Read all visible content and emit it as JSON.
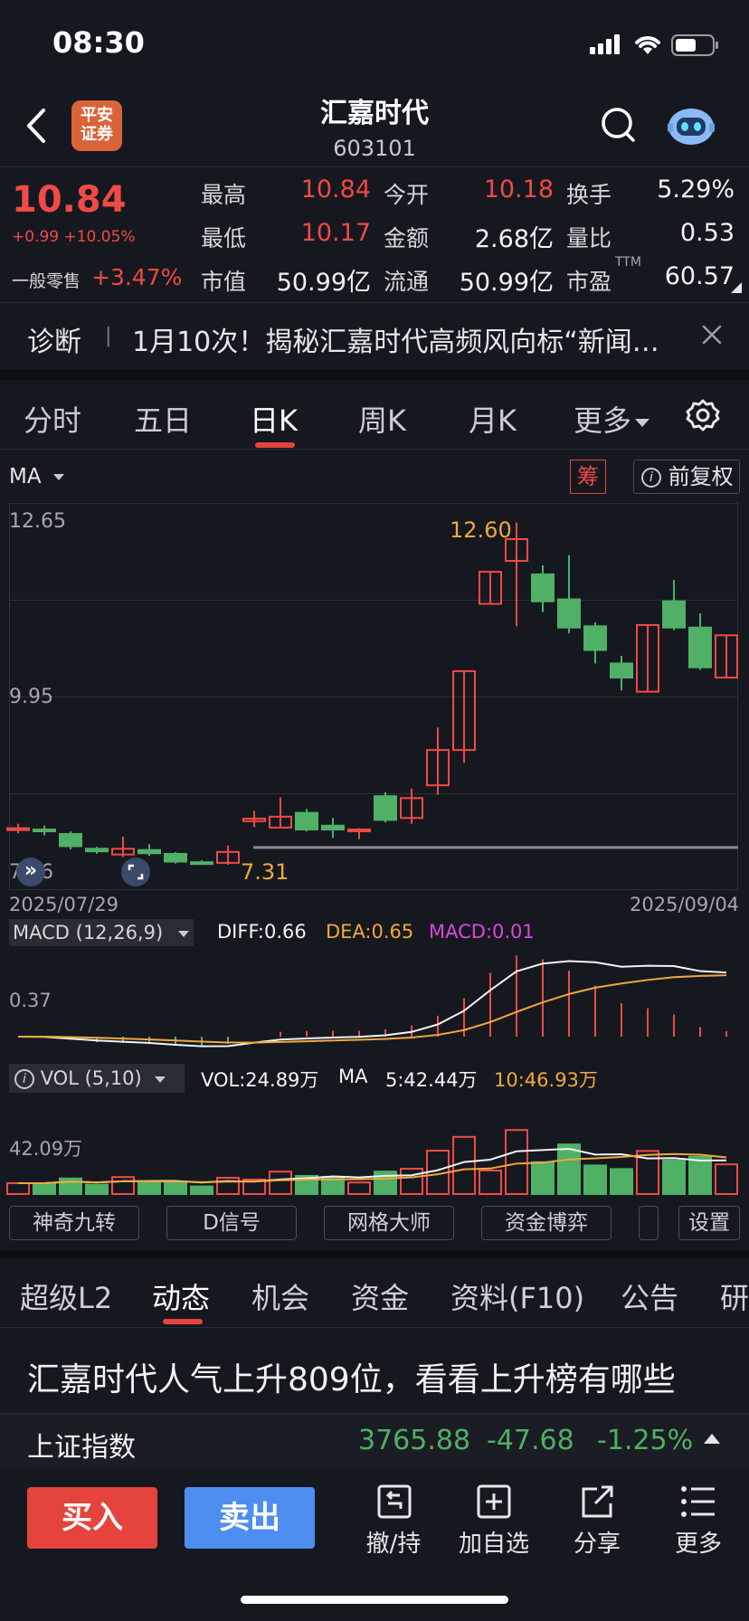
{
  "status": {
    "time": "08:30"
  },
  "header": {
    "title": "汇嘉时代",
    "code": "603101",
    "logo_text_1": "平安",
    "logo_text_2": "证券"
  },
  "quote": {
    "price": "10.84",
    "change": "+0.99 +10.05%",
    "retail_label": "一般零售",
    "retail_change": "+3.47%",
    "rows": [
      [
        {
          "label": "最高",
          "value": "10.84",
          "color": "red"
        },
        {
          "label": "今开",
          "value": "10.18",
          "color": "red"
        },
        {
          "label": "换手",
          "value": "5.29%",
          "color": "white"
        }
      ],
      [
        {
          "label": "最低",
          "value": "10.17",
          "color": "red"
        },
        {
          "label": "金额",
          "value": "2.68亿",
          "color": "white"
        },
        {
          "label": "量比",
          "value": "0.53",
          "color": "white"
        }
      ],
      [
        {
          "label": "市值",
          "value": "50.99亿",
          "color": "white"
        },
        {
          "label": "流通",
          "value": "50.99亿",
          "color": "white"
        },
        {
          "label": "市盈",
          "value": "60.57",
          "color": "white"
        }
      ]
    ],
    "pe_superscript": "TTM"
  },
  "diagnosis": {
    "label": "诊断",
    "separator": "|",
    "text": "1月10次！揭秘汇嘉时代高频风向标“新闻…"
  },
  "chart_tabs": [
    "分时",
    "五日",
    "日K",
    "周K",
    "月K",
    "更多"
  ],
  "chart_active_tab": 2,
  "chart_toolbar": {
    "ma_label": "MA",
    "chip_label": "筹",
    "adjust_label": "前复权"
  },
  "chart_data": {
    "type": "candlestick",
    "y_top_label": "12.65",
    "y_mid_label": "9.95",
    "y_bottom_label": "7.26",
    "x_start": "2025/07/29",
    "x_end": "2025/09/04",
    "high_marker": "12.60",
    "low_marker": "7.31",
    "ylim": [
      7.26,
      12.65
    ],
    "candles": [
      {
        "o": 7.83,
        "c": 7.83,
        "h": 7.9,
        "l": 7.75
      },
      {
        "o": 7.81,
        "c": 7.79,
        "h": 7.87,
        "l": 7.72
      },
      {
        "o": 7.74,
        "c": 7.55,
        "h": 7.78,
        "l": 7.5
      },
      {
        "o": 7.51,
        "c": 7.47,
        "h": 7.54,
        "l": 7.43
      },
      {
        "o": 7.42,
        "c": 7.51,
        "h": 7.7,
        "l": 7.38
      },
      {
        "o": 7.49,
        "c": 7.44,
        "h": 7.58,
        "l": 7.4
      },
      {
        "o": 7.43,
        "c": 7.31,
        "h": 7.46,
        "l": 7.28
      },
      {
        "o": 7.3,
        "c": 7.29,
        "h": 7.33,
        "l": 7.27
      },
      {
        "o": 7.29,
        "c": 7.46,
        "h": 7.56,
        "l": 7.26
      },
      {
        "o": 7.94,
        "c": 7.98,
        "h": 8.1,
        "l": 7.85
      },
      {
        "o": 7.84,
        "c": 8.01,
        "h": 8.31,
        "l": 7.84
      },
      {
        "o": 8.07,
        "c": 7.81,
        "h": 8.13,
        "l": 7.78
      },
      {
        "o": 7.87,
        "c": 7.81,
        "h": 7.99,
        "l": 7.68
      },
      {
        "o": 7.81,
        "c": 7.81,
        "h": 7.83,
        "l": 7.66
      },
      {
        "o": 8.33,
        "c": 7.96,
        "h": 8.39,
        "l": 7.92
      },
      {
        "o": 7.99,
        "c": 8.3,
        "h": 8.45,
        "l": 7.9
      },
      {
        "o": 8.5,
        "c": 9.05,
        "h": 9.4,
        "l": 8.35
      },
      {
        "o": 9.05,
        "c": 10.28,
        "h": 10.28,
        "l": 8.85
      },
      {
        "o": 11.33,
        "c": 11.83,
        "h": 11.83,
        "l": 11.33
      },
      {
        "o": 12.0,
        "c": 12.34,
        "h": 12.6,
        "l": 10.98
      },
      {
        "o": 11.79,
        "c": 11.37,
        "h": 11.93,
        "l": 11.2
      },
      {
        "o": 11.4,
        "c": 10.96,
        "h": 12.09,
        "l": 10.87
      },
      {
        "o": 10.98,
        "c": 10.61,
        "h": 11.04,
        "l": 10.4
      },
      {
        "o": 10.4,
        "c": 10.18,
        "h": 10.52,
        "l": 9.98
      },
      {
        "o": 9.96,
        "c": 11.0,
        "h": 11.0,
        "l": 9.96
      },
      {
        "o": 11.37,
        "c": 10.96,
        "h": 11.7,
        "l": 10.92
      },
      {
        "o": 10.96,
        "c": 10.34,
        "h": 11.18,
        "l": 10.3
      },
      {
        "o": 10.18,
        "c": 10.84,
        "h": 10.84,
        "l": 10.17
      }
    ],
    "macd": {
      "label": "MACD (12,26,9)",
      "diff": "DIFF:0.66",
      "dea": "DEA:0.65",
      "value": "MACD:0.01",
      "y_label": "0.37"
    },
    "vol": {
      "label": "VOL (5,10)",
      "vol": "VOL:24.89万",
      "ma_label": "MA",
      "ma5": "5:42.44万",
      "ma10": "10:46.93万",
      "y_label": "42.09万"
    }
  },
  "indicator_buttons": [
    "神奇九转",
    "D信号",
    "网格大师",
    "资金博弈",
    "设置"
  ],
  "bottom_tabs": [
    "超级L2",
    "动态",
    "机会",
    "资金",
    "资料(F10)",
    "公告",
    "研"
  ],
  "bottom_active_tab": 1,
  "news_headline": "汇嘉时代人气上升809位，看看上升榜有哪些",
  "index_bar": {
    "name": "上证指数",
    "value": "3765.88",
    "change": "-47.68",
    "pct": "-1.25%"
  },
  "actions": {
    "buy": "买入",
    "sell": "卖出",
    "cancel": "撤/持",
    "watch": "加自选",
    "share": "分享",
    "more": "更多"
  },
  "colors": {
    "up": "#f04a45",
    "down": "#4fb066",
    "buy": "#e5433d",
    "sell": "#4e8ef0",
    "bg": "#161820"
  }
}
